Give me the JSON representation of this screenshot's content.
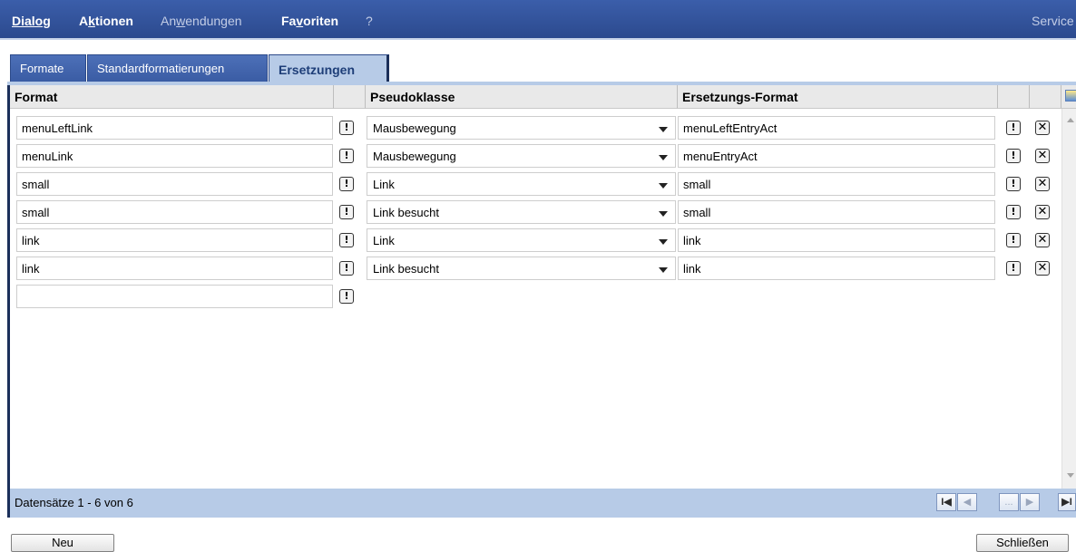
{
  "menu": {
    "dialog": "Dialog",
    "aktionen_prefix": "A",
    "aktionen_u": "k",
    "aktionen_suffix": "tionen",
    "anwendungen_prefix": "An",
    "anwendungen_u": "w",
    "anwendungen_suffix": "endungen",
    "favoriten_prefix": "Fa",
    "favoriten_u": "v",
    "favoriten_suffix": "oriten",
    "help": "?",
    "service": "Service"
  },
  "tabs": [
    {
      "label": "Formate",
      "active": false
    },
    {
      "label": "Standardformatierungen",
      "active": false
    },
    {
      "label": "Ersetzungen",
      "active": true
    }
  ],
  "columns": {
    "format": "Format",
    "pseudoklasse": "Pseudoklasse",
    "ersetzungs_format": "Ersetzungs-Format"
  },
  "rows": [
    {
      "format": "menuLeftLink",
      "pseudo": "Mausbewegung",
      "replace": "menuLeftEntryAct"
    },
    {
      "format": "menuLink",
      "pseudo": "Mausbewegung",
      "replace": "menuEntryAct"
    },
    {
      "format": "small",
      "pseudo": "Link",
      "replace": "small"
    },
    {
      "format": "small",
      "pseudo": "Link besucht",
      "replace": "small"
    },
    {
      "format": "link",
      "pseudo": "Link",
      "replace": "link"
    },
    {
      "format": "link",
      "pseudo": "Link besucht",
      "replace": "link"
    }
  ],
  "new_row": {
    "format": ""
  },
  "icons": {
    "exclaim": "!",
    "delete": "✕"
  },
  "footer": {
    "status": "Datensätze 1 - 6 von 6",
    "pager_first": "I◀",
    "pager_prev": "◀",
    "pager_more": "...",
    "pager_next": "▶",
    "pager_last": "▶I"
  },
  "buttons": {
    "neu": "Neu",
    "schliessen": "Schließen"
  },
  "colors": {
    "menubar": "#2c4a8e",
    "tab_active_bg": "#b7cbe7",
    "accent_dark": "#1b2f5a"
  }
}
